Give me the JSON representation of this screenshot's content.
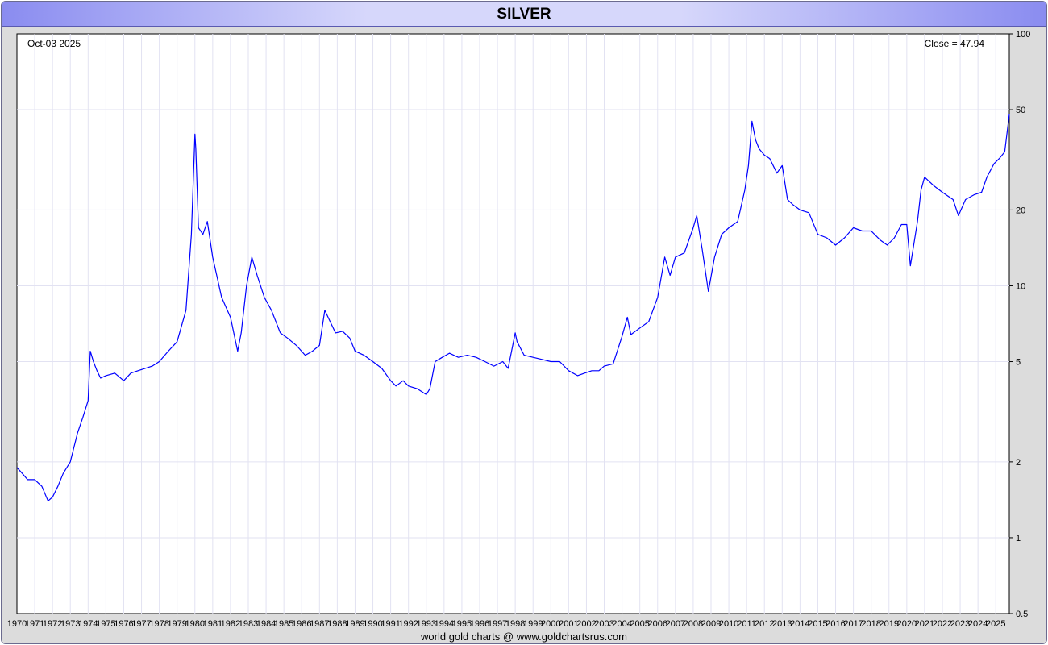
{
  "window": {
    "title": "SILVER"
  },
  "footer": {
    "credit": "world gold charts @ www.goldchartsrus.com"
  },
  "chart_data": {
    "type": "line",
    "title": "SILVER",
    "date_label": "Oct-03  2025",
    "close_label": "Close = 47.94",
    "y_scale": "log",
    "ylim": [
      0.5,
      100
    ],
    "y_ticks": [
      100,
      50,
      20,
      10,
      5,
      2,
      1,
      0.5
    ],
    "xlim": [
      1970.0,
      2025.76
    ],
    "x_ticks": [
      "1970",
      "1971",
      "1972",
      "1973",
      "1974",
      "1975",
      "1976",
      "1977",
      "1978",
      "1979",
      "1980",
      "1981",
      "1982",
      "1983",
      "1984",
      "1985",
      "1986",
      "1987",
      "1988",
      "1989",
      "1990",
      "1991",
      "1992",
      "1993",
      "1994",
      "1995",
      "1996",
      "1997",
      "1998",
      "1999",
      "2000",
      "2001",
      "2002",
      "2003",
      "2004",
      "2005",
      "2006",
      "2007",
      "2008",
      "2009",
      "2010",
      "2011",
      "2012",
      "2013",
      "2014",
      "2015",
      "2016",
      "2017",
      "2018",
      "2019",
      "2020",
      "2021",
      "2022",
      "2023",
      "2024",
      "2025"
    ],
    "grid": true,
    "line_color": "#0000ff",
    "series": [
      {
        "x": [
          1970.0,
          1970.3,
          1970.6,
          1971.0,
          1971.4,
          1971.75,
          1972.0,
          1972.3,
          1972.6,
          1973.0,
          1973.4,
          1973.7,
          1974.0,
          1974.12,
          1974.3,
          1974.5,
          1974.7,
          1975.0,
          1975.5,
          1976.0,
          1976.4,
          1976.8,
          1977.2,
          1977.6,
          1978.0,
          1978.5,
          1979.0,
          1979.5,
          1979.8,
          1980.0,
          1980.05,
          1980.2,
          1980.45,
          1980.7,
          1981.0,
          1981.5,
          1982.0,
          1982.4,
          1982.6,
          1982.9,
          1983.2,
          1983.5,
          1983.9,
          1984.3,
          1984.8,
          1985.2,
          1985.7,
          1986.2,
          1986.6,
          1987.0,
          1987.3,
          1987.6,
          1987.9,
          1988.3,
          1988.7,
          1989.0,
          1989.5,
          1990.0,
          1990.5,
          1991.0,
          1991.3,
          1991.7,
          1992.0,
          1992.5,
          1993.0,
          1993.2,
          1993.5,
          1993.9,
          1994.3,
          1994.8,
          1995.3,
          1995.8,
          1996.3,
          1996.8,
          1997.3,
          1997.6,
          1998.0,
          1998.1,
          1998.5,
          1999.0,
          1999.5,
          2000.0,
          2000.5,
          2001.0,
          2001.5,
          2001.9,
          2002.3,
          2002.7,
          2003.0,
          2003.5,
          2004.0,
          2004.3,
          2004.5,
          2005.0,
          2005.5,
          2006.0,
          2006.4,
          2006.7,
          2007.0,
          2007.5,
          2008.0,
          2008.2,
          2008.5,
          2008.85,
          2009.2,
          2009.6,
          2010.0,
          2010.5,
          2010.9,
          2011.1,
          2011.3,
          2011.5,
          2011.7,
          2012.0,
          2012.3,
          2012.7,
          2013.0,
          2013.3,
          2013.6,
          2014.0,
          2014.5,
          2015.0,
          2015.5,
          2016.0,
          2016.5,
          2017.0,
          2017.5,
          2018.0,
          2018.5,
          2018.9,
          2019.3,
          2019.7,
          2020.0,
          2020.2,
          2020.6,
          2020.8,
          2021.0,
          2021.5,
          2022.0,
          2022.6,
          2022.9,
          2023.3,
          2023.8,
          2024.2,
          2024.5,
          2024.9,
          2025.2,
          2025.5,
          2025.76
        ],
        "y": [
          1.9,
          1.8,
          1.7,
          1.7,
          1.6,
          1.4,
          1.45,
          1.6,
          1.8,
          2.0,
          2.6,
          3.0,
          3.5,
          5.5,
          5.0,
          4.6,
          4.3,
          4.4,
          4.5,
          4.2,
          4.5,
          4.6,
          4.7,
          4.8,
          5.0,
          5.5,
          6.0,
          8.0,
          16.0,
          40.0,
          35.0,
          17.0,
          16.0,
          18.0,
          13.0,
          9.0,
          7.5,
          5.5,
          6.5,
          10.0,
          13.0,
          11.0,
          9.0,
          8.0,
          6.5,
          6.2,
          5.8,
          5.3,
          5.5,
          5.8,
          8.0,
          7.2,
          6.5,
          6.6,
          6.2,
          5.5,
          5.3,
          5.0,
          4.7,
          4.2,
          4.0,
          4.2,
          4.0,
          3.9,
          3.7,
          3.9,
          5.0,
          5.2,
          5.4,
          5.2,
          5.3,
          5.2,
          5.0,
          4.8,
          5.0,
          4.7,
          6.5,
          6.0,
          5.3,
          5.2,
          5.1,
          5.0,
          5.0,
          4.6,
          4.4,
          4.5,
          4.6,
          4.6,
          4.8,
          4.9,
          6.3,
          7.5,
          6.4,
          6.8,
          7.2,
          9.0,
          13.0,
          11.0,
          13.0,
          13.5,
          17.0,
          19.0,
          14.0,
          9.5,
          13.0,
          16.0,
          17.0,
          18.0,
          24.0,
          30.0,
          45.0,
          38.0,
          35.0,
          33.0,
          32.0,
          28.0,
          30.0,
          22.0,
          21.0,
          20.0,
          19.5,
          16.0,
          15.5,
          14.5,
          15.5,
          17.0,
          16.5,
          16.5,
          15.2,
          14.5,
          15.5,
          17.5,
          17.5,
          12.0,
          18.0,
          24.0,
          27.0,
          25.0,
          23.5,
          22.0,
          19.0,
          22.0,
          23.0,
          23.5,
          27.0,
          30.5,
          32.0,
          34.0,
          47.94
        ]
      }
    ]
  }
}
